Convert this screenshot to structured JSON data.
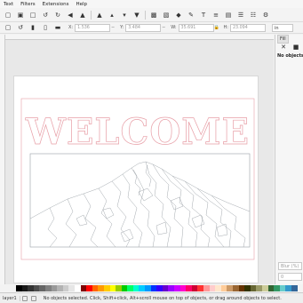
{
  "menu": [
    "Text",
    "Filters",
    "Extensions",
    "Help"
  ],
  "toolbar": {
    "x_label": "X:",
    "x_value": "1.536",
    "y_label": "Y:",
    "y_value": "3.484",
    "w_label": "W:",
    "w_value": "35.691",
    "h_label": "H:",
    "h_value": "23.094",
    "unit": "in"
  },
  "design_text": "WELCOME",
  "panel": {
    "tab_label": "Fill",
    "no_objects": "No objects",
    "blur_label": "Blur (%)",
    "opacity_value": "0"
  },
  "status": {
    "layer": "layer1",
    "message": "No objects selected. Click, Shift+click, Alt+scroll mouse on top of objects, or drag around objects to select."
  },
  "colors": {
    "accent": "#e8a0a8",
    "outline": "#9aa0a6",
    "palette": [
      "#000000",
      "#1a1a1a",
      "#333333",
      "#4d4d4d",
      "#666666",
      "#808080",
      "#999999",
      "#b3b3b3",
      "#cccccc",
      "#e6e6e6",
      "#ffffff",
      "#800000",
      "#ff0000",
      "#ff6600",
      "#ff9900",
      "#ffcc00",
      "#ffff00",
      "#99cc00",
      "#00cc00",
      "#00ff66",
      "#00ffcc",
      "#00ccff",
      "#0099ff",
      "#0033ff",
      "#3300ff",
      "#6600cc",
      "#9900ff",
      "#cc00ff",
      "#ff00cc",
      "#ff0066",
      "#cc0033",
      "#ff3333",
      "#ff9999",
      "#ffcccc",
      "#ffe6cc",
      "#ffcc99",
      "#cc9966",
      "#996633",
      "#663300",
      "#333300",
      "#666633",
      "#999966",
      "#cccc99",
      "#336633",
      "#339966",
      "#66cccc",
      "#3399cc",
      "#336699"
    ]
  }
}
